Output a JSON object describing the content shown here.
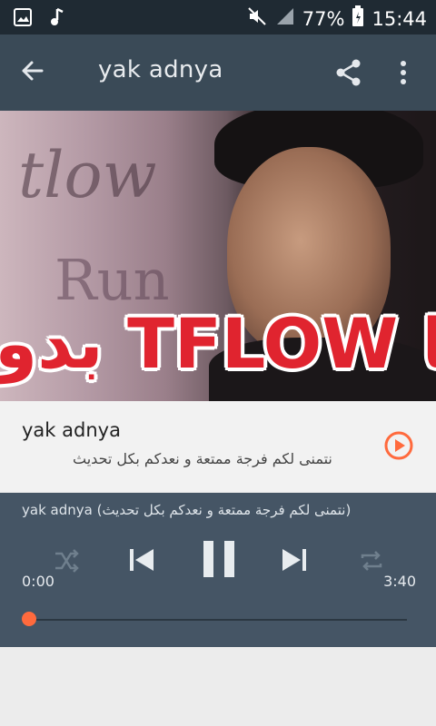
{
  "status_bar": {
    "battery": "77%",
    "time": "15:44",
    "icons": [
      "image-icon",
      "music-note-icon",
      "mute-icon",
      "signal-icon",
      "battery-icon"
    ]
  },
  "toolbar": {
    "title": "yak adnya",
    "icons": [
      "back-arrow-icon",
      "share-icon",
      "more-vert-icon"
    ]
  },
  "artwork": {
    "overlay_text": "بدو TFLOW با",
    "script_text": "tlow",
    "run_text": "Run"
  },
  "song": {
    "name": "yak adnya",
    "description": "نتمنى لكم فرجة ممتعة و نعدكم بكل تحديث"
  },
  "player": {
    "now_playing": "yak adnya (نتمنى لكم فرجة ممتعة و نعدكم بكل تحديث)",
    "current_time": "0:00",
    "total_time": "3:40",
    "progress": 0.0
  },
  "colors": {
    "accent": "#ff6a3d",
    "toolbar": "#3a4a57",
    "status_bar": "#1f2a33",
    "player": "#455565"
  }
}
